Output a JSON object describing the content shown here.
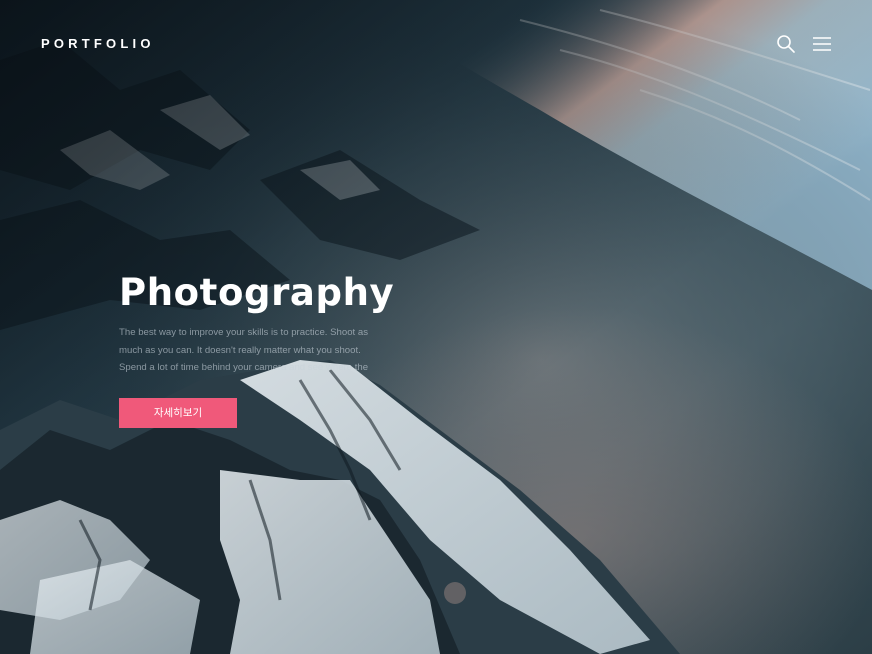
{
  "header": {
    "logo": "PORTFOLIO",
    "search_icon": "search-icon",
    "menu_icon": "hamburger-menu-icon"
  },
  "hero": {
    "title": "Photography",
    "description": "The best way to improve your skills is to practice. Shoot as much as you can. It doesn't really matter what you shoot. Spend a lot of time behind your camera and see where the",
    "cta_label": "자세히보기",
    "background": "aerial-mountains-photo"
  },
  "colors": {
    "accent": "#f0597a",
    "text": "#ffffff"
  }
}
